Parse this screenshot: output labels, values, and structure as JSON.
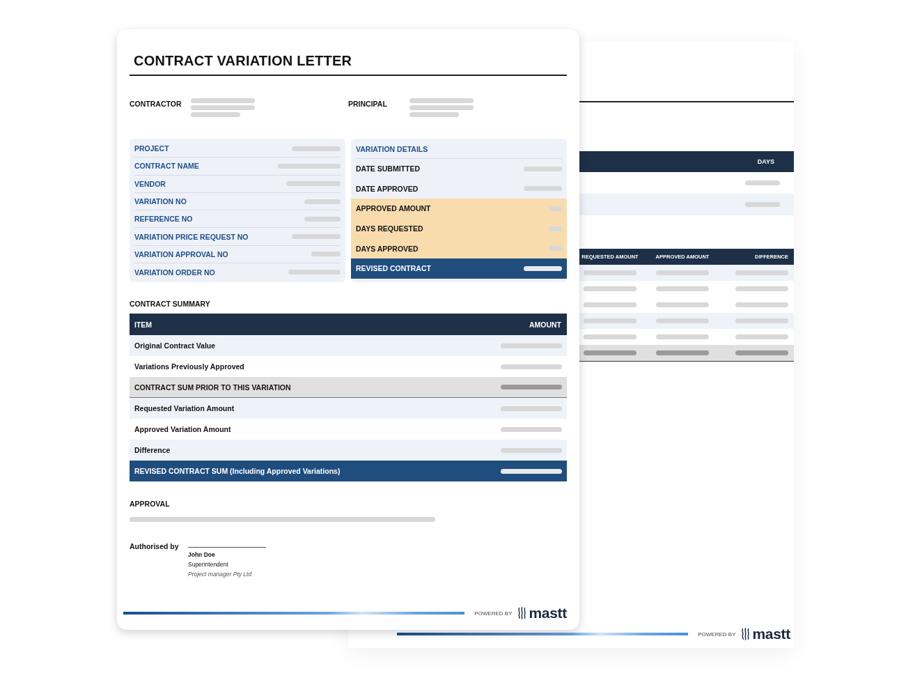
{
  "back_document": {
    "days_table": {
      "columns": [
        "DAYS"
      ],
      "rows": [
        {
          "kind": "white"
        },
        {
          "kind": "light"
        }
      ]
    },
    "amounts_table": {
      "columns": [
        "REQUESTED AMOUNT",
        "APPROVED AMOUNT",
        "DIFFERENCE"
      ],
      "rows": [
        {
          "kind": "light"
        },
        {
          "kind": "white"
        },
        {
          "kind": "white"
        },
        {
          "kind": "light"
        },
        {
          "kind": "white"
        },
        {
          "kind": "subtotal"
        }
      ]
    },
    "footer": {
      "powered_by": "POWERED BY",
      "logo": "mastt"
    }
  },
  "document": {
    "title": "CONTRACT VARIATION LETTER",
    "parties": [
      {
        "label": "CONTRACTOR"
      },
      {
        "label": "PRINCIPAL"
      }
    ],
    "info_fields": [
      {
        "label": "PROJECT"
      },
      {
        "label": "CONTRACT NAME"
      },
      {
        "label": "VENDOR"
      },
      {
        "label": "VARIATION NO"
      },
      {
        "label": "REFERENCE NO"
      },
      {
        "label": "VARIATION PRICE REQUEST NO"
      },
      {
        "label": "VARIATION APPROVAL NO"
      },
      {
        "label": "VARIATION ORDER NO"
      }
    ],
    "variation_details": {
      "heading": "VARIATION DETAILS",
      "rows": [
        {
          "label": "DATE SUBMITTED",
          "kind": "plain"
        },
        {
          "label": "DATE APPROVED",
          "kind": "plain"
        },
        {
          "label": "APPROVED AMOUNT",
          "kind": "highlight"
        },
        {
          "label": "DAYS REQUESTED",
          "kind": "highlight"
        },
        {
          "label": "DAYS APPROVED",
          "kind": "highlight"
        },
        {
          "label": "REVISED CONTRACT",
          "kind": "total"
        }
      ]
    },
    "summary": {
      "heading": "CONTRACT SUMMARY",
      "columns": [
        "ITEM",
        "AMOUNT"
      ],
      "rows": [
        {
          "item": "Original Contract Value",
          "kind": "light"
        },
        {
          "item": "Variations Previously Approved",
          "kind": "white"
        },
        {
          "item": "CONTRACT SUM PRIOR TO THIS VARIATION",
          "kind": "subtotal"
        },
        {
          "item": "Requested Variation Amount",
          "kind": "light"
        },
        {
          "item": "Approved Variation Amount",
          "kind": "white"
        },
        {
          "item": "Difference",
          "kind": "light"
        },
        {
          "item": "REVISED CONTRACT SUM (Including Approved Variations)",
          "kind": "total"
        }
      ]
    },
    "approval": {
      "heading": "APPROVAL",
      "authorised_label": "Authorised by",
      "name": "John Doe",
      "role": "Superintendent",
      "company": "Project manager Pty Ltd"
    },
    "footer": {
      "powered_by": "POWERED BY",
      "logo": "mastt"
    }
  }
}
